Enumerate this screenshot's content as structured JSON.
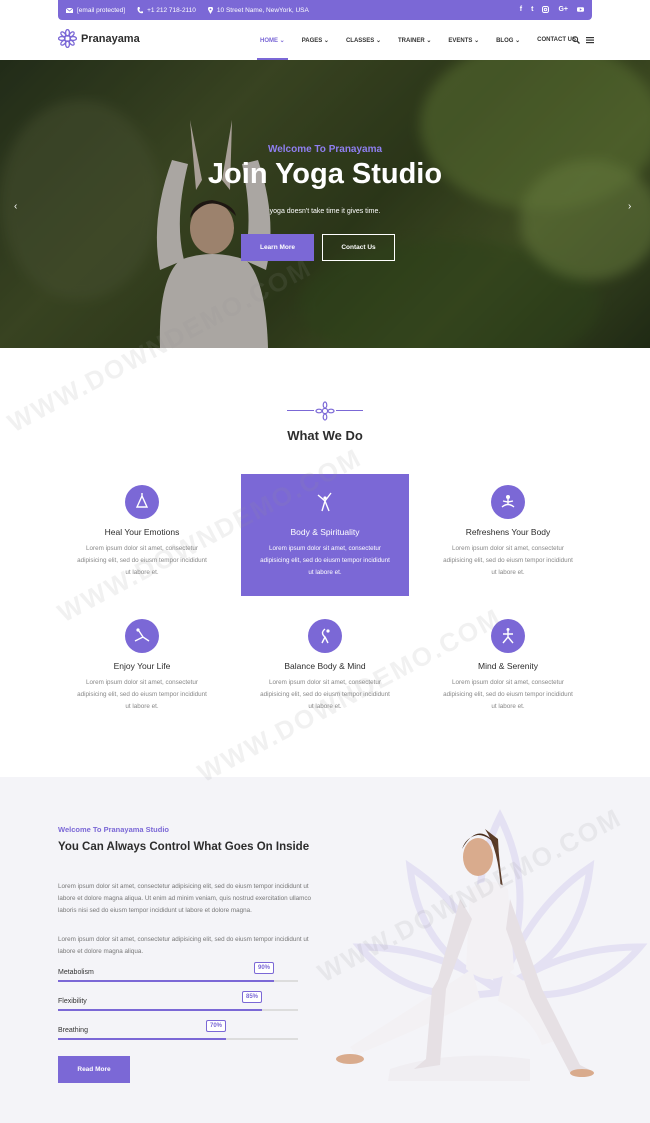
{
  "topbar": {
    "email": "[email protected]",
    "phone": "+1 212 718-2110",
    "address": "10 Street Name, NewYork, USA",
    "socials": [
      "f",
      "t",
      "ig",
      "G+",
      "yt"
    ]
  },
  "brand": {
    "name": "Pranayama",
    "accent": "#7b68d6"
  },
  "nav": {
    "items": [
      "HOME ⌄",
      "PAGES ⌄",
      "CLASSES ⌄",
      "TRAINER ⌄",
      "EVENTS ⌄",
      "BLOG ⌄",
      "CONTACT US"
    ],
    "active": "HOME"
  },
  "hero": {
    "subtitle": "Welcome To Pranayama",
    "title": "Join Yoga Studio",
    "tagline": "yoga doesn't take time it gives time.",
    "learn_label": "Learn More",
    "contact_label": "Contact Us",
    "prev": "‹",
    "next": "›"
  },
  "what_we_do": {
    "title": "What We Do",
    "cards": [
      {
        "title": "Heal Your Emotions",
        "text": "Lorem ipsum dolor sit amet, consectetur adipisicing elit, sed do eiusm tempor incididunt ut labore et."
      },
      {
        "title": "Body & Spirituality",
        "text": "Lorem ipsum dolor sit amet, consectetur adipisicing elit, sed do eiusm tempor incididunt ut labore et."
      },
      {
        "title": "Refreshens Your Body",
        "text": "Lorem ipsum dolor sit amet, consectetur adipisicing elit, sed do eiusm tempor incididunt ut labore et."
      },
      {
        "title": "Enjoy Your Life",
        "text": "Lorem ipsum dolor sit amet, consectetur adipisicing elit, sed do eiusm tempor incididunt ut labore et."
      },
      {
        "title": "Balance Body & Mind",
        "text": "Lorem ipsum dolor sit amet, consectetur adipisicing elit, sed do eiusm tempor incididunt ut labore et."
      },
      {
        "title": "Mind & Serenity",
        "text": "Lorem ipsum dolor sit amet, consectetur adipisicing elit, sed do eiusm tempor incididunt ut labore et."
      }
    ]
  },
  "about": {
    "subtitle": "Welcome To Pranayama Studio",
    "title": "You Can Always Control What Goes On Inside",
    "para1": "Lorem ipsum dolor sit amet, consectetur adipisicing elit, sed do eiusm tempor incididunt ut labore et dolore magna aliqua. Ut enim ad minim veniam, quis nostrud exercitation ullamco laboris nisi sed do eiusm tempor incididunt ut labore et dolore magna.",
    "para2": "Lorem ipsum dolor sit amet, consectetur adipisicing elit, sed do eiusm tempor incididunt ut labore et dolore magna aliqua.",
    "skills": [
      {
        "label": "Metabolism",
        "value": 90,
        "badge": "90%"
      },
      {
        "label": "Flexibility",
        "value": 85,
        "badge": "85%"
      },
      {
        "label": "Breathing",
        "value": 70,
        "badge": "70%"
      }
    ],
    "read_label": "Read More"
  },
  "watermark": "WWW.DOWNDEMO.COM"
}
